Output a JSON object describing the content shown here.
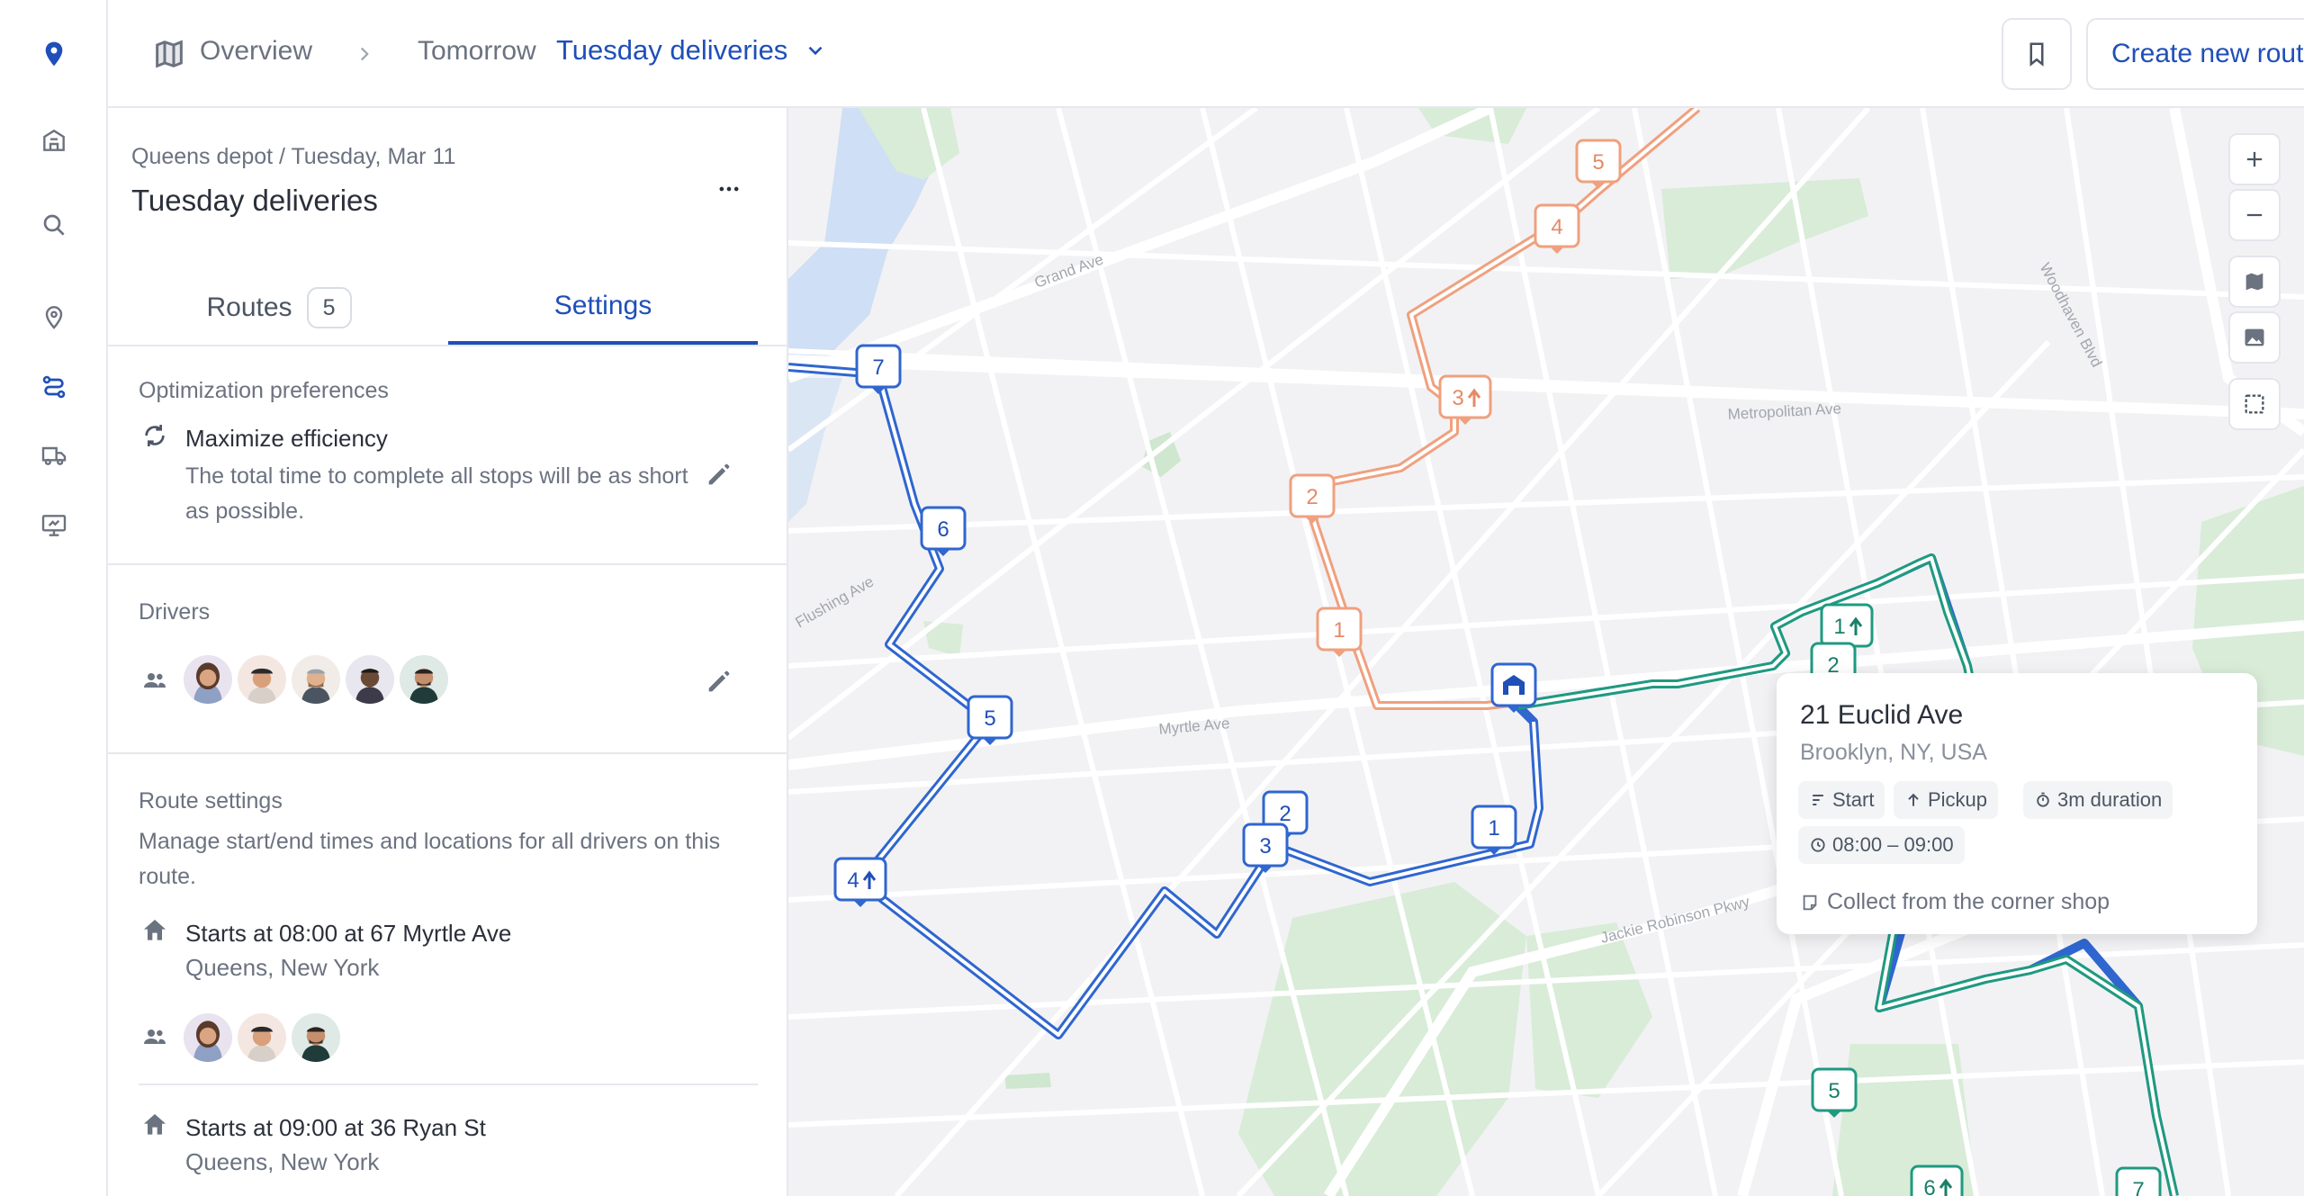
{
  "breadcrumb": {
    "overview": "Overview",
    "day": "Tomorrow",
    "current": "Tuesday deliveries"
  },
  "header": {
    "create_button": "Create new route"
  },
  "panel": {
    "subtitle": "Queens depot / Tuesday, Mar 11",
    "title": "Tuesday deliveries",
    "tabs": {
      "routes_label": "Routes",
      "routes_count": "5",
      "settings_label": "Settings"
    },
    "optimization": {
      "section_title": "Optimization preferences",
      "name": "Maximize efficiency",
      "description": "The total time to complete all stops will be as short as possible."
    },
    "drivers": {
      "section_title": "Drivers"
    },
    "route_settings": {
      "section_title": "Route settings",
      "description": "Manage start/end times and locations for all drivers on this route.",
      "starts": [
        {
          "line": "Starts at 08:00 at 67 Myrtle Ave",
          "area": "Queens, New York"
        },
        {
          "line": "Starts at 09:00 at 36 Ryan St",
          "area": "Queens, New York"
        }
      ]
    }
  },
  "map": {
    "streets": {
      "grand": "Grand Ave",
      "metropolitan": "Metropolitan Ave",
      "woodhaven": "Woodhaven Blvd",
      "flushing": "Flushing Ave",
      "myrtle": "Myrtle Ave",
      "jackie": "Jackie Robinson Pkwy"
    },
    "route_colors": {
      "blue": "#2f66d0",
      "orange": "#f0a07e",
      "green": "#1f9a80"
    },
    "blue_markers": [
      "1",
      "2",
      "3",
      "4",
      "5",
      "6",
      "7"
    ],
    "orange_markers": [
      "1",
      "2",
      "3",
      "4",
      "5"
    ],
    "green_markers": [
      "1",
      "2",
      "5",
      "6",
      "7"
    ],
    "popup": {
      "title": "21 Euclid Ave",
      "subtitle": "Brooklyn, NY, USA",
      "chip_start": "Start",
      "chip_pickup": "Pickup",
      "chip_duration": "3m duration",
      "chip_time": "08:00 – 09:00",
      "note": "Collect from the corner shop"
    }
  }
}
